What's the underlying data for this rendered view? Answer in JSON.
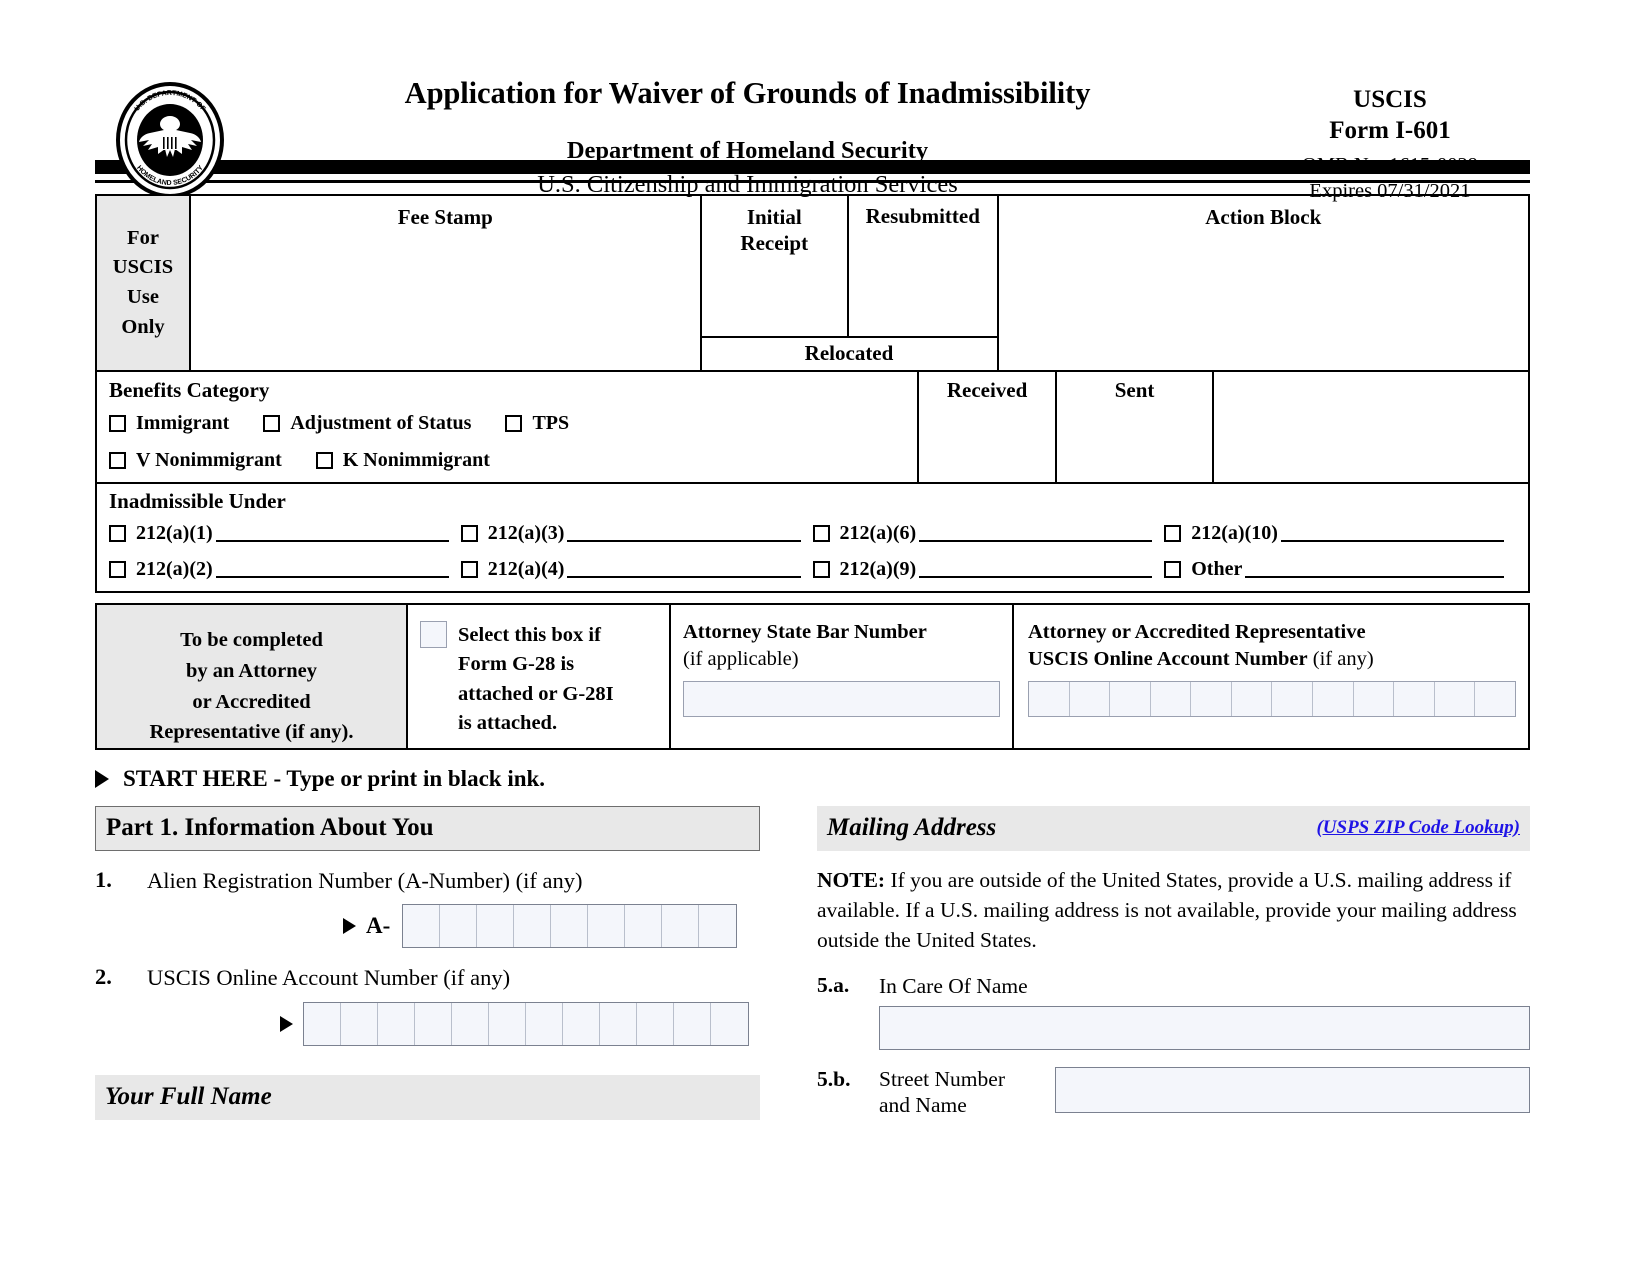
{
  "header": {
    "seal_alt": "dhs-seal",
    "title": "Application for Waiver of Grounds of Inadmissibility",
    "department": "Department of Homeland Security",
    "agency": "U.S. Citizenship and Immigration Services",
    "uscis": "USCIS",
    "form_number": "Form I-601",
    "omb": "OMB No. 1615-0029",
    "expires": "Expires 07/31/2021"
  },
  "uscis_block": {
    "for_uscis_use_only": "For\nUSCIS\nUse\nOnly",
    "for_uscis_use_only_lines": [
      "For",
      "USCIS",
      "Use",
      "Only"
    ],
    "fee_stamp": "Fee Stamp",
    "initial_receipt": "Initial\nReceipt",
    "initial_receipt_lines": [
      "Initial",
      "Receipt"
    ],
    "resubmitted": "Resubmitted",
    "action_block": "Action Block",
    "relocated": "Relocated",
    "received": "Received",
    "sent": "Sent",
    "benefits_category_title": "Benefits Category",
    "benefits_row1": [
      "Immigrant",
      "Adjustment of Status",
      "TPS"
    ],
    "benefits_row2": [
      "V Nonimmigrant",
      "K Nonimmigrant"
    ],
    "inadmissible_title": "Inadmissible Under",
    "inadmissible_row1": [
      "212(a)(1)",
      "212(a)(3)",
      "212(a)(6)",
      "212(a)(10)"
    ],
    "inadmissible_row2": [
      "212(a)(2)",
      "212(a)(4)",
      "212(a)(9)",
      "Other"
    ]
  },
  "attorney_block": {
    "left_lines": [
      "To be completed",
      "by an Attorney",
      "or Accredited",
      "Representative (if any)."
    ],
    "g28_lines": [
      "Select this box if",
      "Form G-28 is",
      "attached or G-28I",
      "is attached."
    ],
    "bar_label_bold": "Attorney State Bar Number",
    "bar_label_normal": "(if applicable)",
    "bar_value": "",
    "online_label_line1": "Attorney or Accredited Representative",
    "online_label_line2_bold": "USCIS Online Account Number",
    "online_label_line2_normal": " (if any)",
    "online_cells": 12,
    "online_value": ""
  },
  "start_here": "START HERE - Type or print in black ink.",
  "part1": {
    "header": "Part 1.  Information About You",
    "q1_num": "1.",
    "q1_text": "Alien Registration Number (A-Number) (if any)",
    "a_prefix": "A-",
    "a_number_cells": 9,
    "a_number_value": "",
    "q2_num": "2.",
    "q2_text": "USCIS Online Account Number (if any)",
    "acct_cells": 12,
    "acct_value": "",
    "full_name_header": "Your Full Name"
  },
  "mailing_address": {
    "header": "Mailing Address",
    "zip_link": "(USPS ZIP Code Lookup)",
    "note_bold": "NOTE:",
    "note_text": "  If you are outside of the United States, provide a U.S. mailing address if available.  If a U.S. mailing address is not available, provide your mailing address outside the United States.",
    "item_5a_num": "5.a.",
    "item_5a_label": "In Care Of Name",
    "item_5a_value": "",
    "item_5b_num": "5.b.",
    "item_5b_label_line1": "Street Number",
    "item_5b_label_line2": "and Name",
    "item_5b_value": ""
  },
  "colors": {
    "shaded": "#e8e8e8",
    "field_fill": "#f4f6fb",
    "field_border": "#7b8190",
    "link": "#1f14e6",
    "rule": "#000000"
  }
}
